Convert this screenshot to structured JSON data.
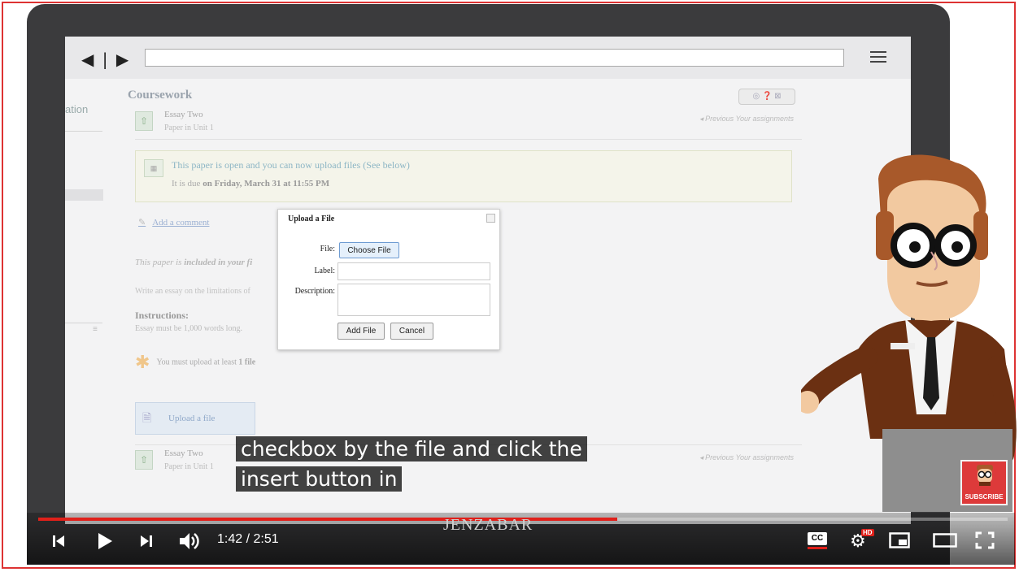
{
  "browser": {
    "nav_glyph": "◀ | ▶"
  },
  "sidebar": {
    "label": "ation"
  },
  "coursework": {
    "title": "Coursework",
    "tools": "◎ ❓ ⊠",
    "item1": {
      "title": "Essay Two",
      "subtitle": "Paper in Unit 1",
      "nav": "◂ Previous   Your assignments"
    },
    "notice": {
      "title": "This paper is open and you can now upload files",
      "title_suffix": " (See below)",
      "due_prefix": "It is due ",
      "due_value": "on Friday, March 31 at 11:55 PM"
    },
    "add_comment": "Add a comment",
    "included_prefix": "This paper is ",
    "included_bold": "included in your fi",
    "write_text": "Write an essay on the limitations of",
    "instructions_heading": "Instructions:",
    "instructions_body": "Essay must be 1,000 words long.",
    "must_upload_prefix": "You must upload at least ",
    "must_upload_bold": "1 file",
    "upload_button": "Upload a file",
    "item2": {
      "title": "Essay Two",
      "subtitle": "Paper in Unit 1",
      "nav": "◂ Previous   Your assignments"
    }
  },
  "dialog": {
    "title": "Upload a File",
    "file_label": "File:",
    "choose_file": "Choose File",
    "label_label": "Label:",
    "description_label": "Description:",
    "add_file": "Add File",
    "cancel": "Cancel"
  },
  "subtitles": {
    "line1": "checkbox by the file and click the",
    "line2": "insert button in"
  },
  "subscribe": "SUBSCRIBE",
  "player": {
    "current_time": "1:42",
    "duration": "2:51",
    "time_display": "1:42 / 2:51",
    "progress": 0.597,
    "brand": "JENZABAR",
    "hd_badge": "HD",
    "cc_label": "CC"
  },
  "colors": {
    "progress": "#e0201a",
    "frame": "#dd3333",
    "laptop": "#3b3b3d"
  }
}
